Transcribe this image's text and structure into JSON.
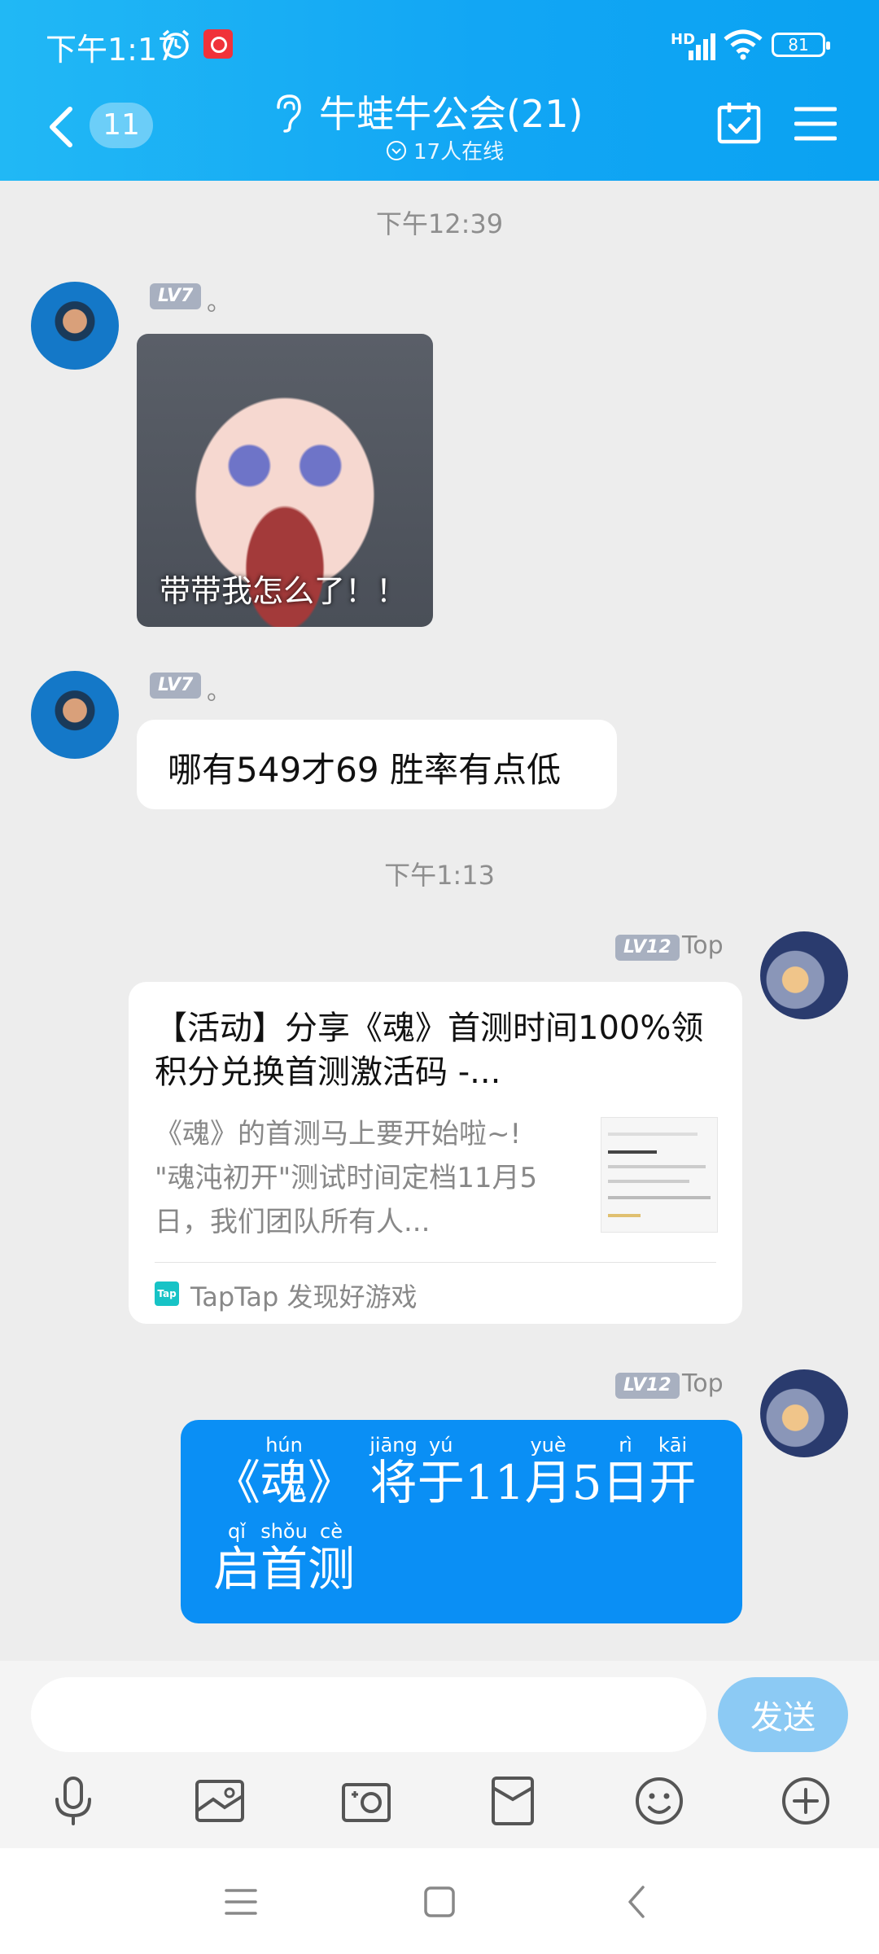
{
  "status_bar": {
    "time": "下午1:17",
    "network": "HD",
    "battery": "81"
  },
  "header": {
    "unread_count": "11",
    "title": "牛蛙牛公会(21)",
    "online": "17人在线"
  },
  "messages": [
    {
      "type": "timestamp",
      "text": "下午12:39"
    },
    {
      "type": "sticker",
      "sender": {
        "level": "LV7",
        "name": "。"
      },
      "caption": "带带我怎么了！！"
    },
    {
      "type": "text",
      "sender": {
        "level": "LV7",
        "name": "。"
      },
      "text": "哪有549才69 胜率有点低"
    },
    {
      "type": "timestamp",
      "text": "下午1:13"
    },
    {
      "type": "link_card",
      "sender": {
        "level": "LV12",
        "name": "Top"
      },
      "title": "【活动】分享《魂》首测时间100%领积分兑换首测激活码 -...",
      "description": "《魂》的首测马上要开始啦~! \"魂沌初开\"测试时间定档11月5日，我们团队所有人...",
      "source_icon_label": "Tap",
      "source": "TapTap 发现好游戏"
    },
    {
      "type": "ruby_text",
      "sender": {
        "level": "LV12",
        "name": "Top"
      },
      "chars": [
        {
          "char": "《",
          "pinyin": ""
        },
        {
          "char": "魂",
          "pinyin": "hún"
        },
        {
          "char": "》",
          "pinyin": ""
        },
        {
          "char": "将",
          "pinyin": "jiāng"
        },
        {
          "char": "于",
          "pinyin": "yú"
        },
        {
          "char": "11",
          "pinyin": ""
        },
        {
          "char": "月",
          "pinyin": "yuè"
        },
        {
          "char": "5",
          "pinyin": ""
        },
        {
          "char": "日",
          "pinyin": "rì"
        },
        {
          "char": "开",
          "pinyin": "kāi"
        },
        {
          "char": "启",
          "pinyin": "qǐ"
        },
        {
          "char": "首",
          "pinyin": "shǒu"
        },
        {
          "char": "测",
          "pinyin": "cè"
        }
      ]
    }
  ],
  "input": {
    "placeholder": "",
    "send_label": "发送"
  },
  "toolbar": [
    "microphone-icon",
    "image-icon",
    "camera-icon",
    "red-packet-icon",
    "emoji-icon",
    "plus-icon"
  ],
  "colors": {
    "header": "#12a6f4",
    "bubble_blue": "#0a8ff5",
    "send_button": "#8ccaf4"
  }
}
